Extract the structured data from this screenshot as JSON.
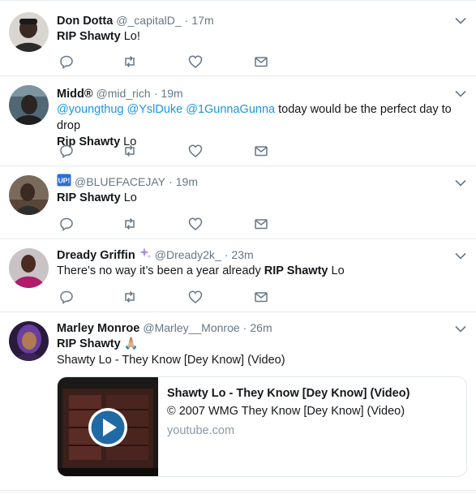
{
  "tweets": [
    {
      "fullname": "Don Dotta",
      "handle": "@_capitalD_",
      "time": "17m",
      "text_bold": "RIP Shawty",
      "text_after": " Lo!"
    },
    {
      "fullname": "Midd®",
      "handle": "@mid_rich",
      "time": "19m",
      "mention1": "@youngthug",
      "mention2": "@YslDuke",
      "mention3": "@1GunnaGunna",
      "text_mid": " today would be the perfect day to drop",
      "text_bold": "Rip Shawty",
      "text_after": " Lo"
    },
    {
      "fullname": "",
      "handle": "@BLUEFACEJAY",
      "time": "19m",
      "text_bold": "RIP Shawty",
      "text_after": " Lo"
    },
    {
      "fullname": "Dready Griffin",
      "handle": "@Dready2k_",
      "time": "23m",
      "text_before": "There’s no way it’s been a year already ",
      "text_bold": "RIP Shawty",
      "text_after": " Lo"
    },
    {
      "fullname": "Marley Monroe",
      "handle": "@Marley__Monroe",
      "time": "26m",
      "text_bold": "RIP Shawty",
      "text_emoji": "🙏🏼",
      "text_line2": "Shawty Lo - They Know [Dey Know] (Video)",
      "card": {
        "title": "Shawty Lo - They Know [Dey Know] (Video)",
        "description": "© 2007 WMG They Know [Dey Know] (Video)",
        "domain": "youtube.com"
      }
    }
  ],
  "separator": "·",
  "colors": {
    "link": "#1b95e0",
    "muted": "#657786",
    "icon": "#657786",
    "border": "#e6ecf0",
    "play_button": "#1f6aa5"
  }
}
